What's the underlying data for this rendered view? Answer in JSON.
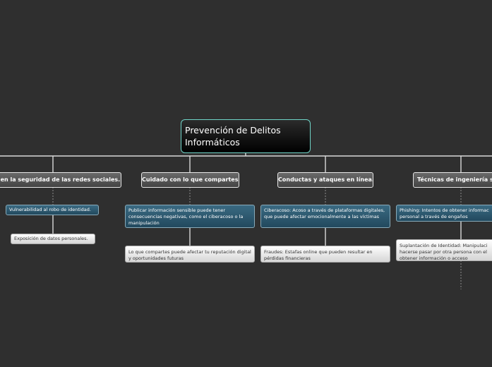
{
  "root": {
    "line1": "Prevención de Delitos",
    "line2": "Informáticos"
  },
  "branches": [
    {
      "label": "sgo en la seguridad de las redes sociales.",
      "children": [
        "Vulnerabilidad al robo de identidad.",
        "Exposición de datos personales."
      ]
    },
    {
      "label": "Cuidado con lo que compartes.",
      "children": [
        "Publicar información sensible puede tener consecuencias negativas, como el ciberacoso o la manipulación",
        "Lo que compartes puede afectar tu reputación digital y oportunidades futuras"
      ]
    },
    {
      "label": "Conductas y ataques en línea.",
      "children": [
        "Ciberacoso: Acoso a través de plataformas digitales, que puede afectar emocionalmente a las víctimas",
        "Fraudes: Estafas online que pueden resultar en pérdidas financieras"
      ]
    },
    {
      "label": "Técnicas de ingeniería soc",
      "children": [
        "Phishing: Intentos de obtener informac personal a través de engaños",
        "Suplantación de Identidad: Manipulaci hacerse pasar por otra persona con el obtener información o acceso"
      ]
    }
  ],
  "colors": {
    "background": "#2f2f2f",
    "root_border": "#6fd4c7",
    "connector": "#d9d9d9",
    "blue_node": "#2f5d74",
    "grey_node": "#ececec"
  }
}
